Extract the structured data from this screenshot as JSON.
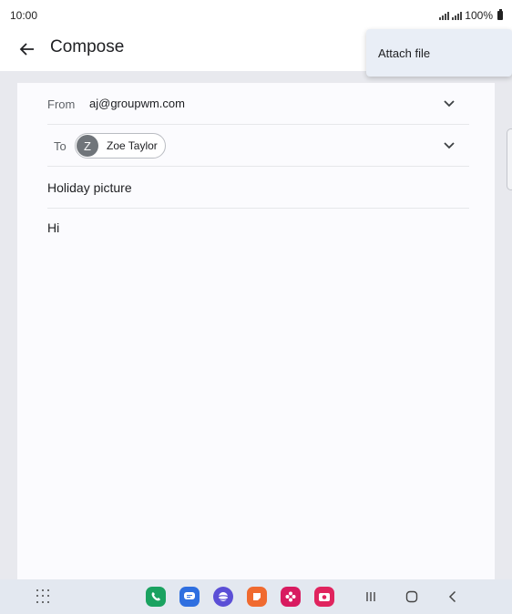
{
  "status_bar": {
    "time": "10:00",
    "battery": "100%",
    "icons": [
      "signal-icon",
      "signal-icon",
      "battery-icon"
    ]
  },
  "app_bar": {
    "title": "Compose",
    "back_icon": "arrow-back-icon"
  },
  "menu": {
    "items": [
      {
        "label": "Attach file"
      }
    ]
  },
  "compose": {
    "from": {
      "label": "From",
      "value": "aj@groupwm.com"
    },
    "to": {
      "label": "To",
      "recipient": {
        "initial": "Z",
        "name": "Zoe Taylor"
      }
    },
    "subject": "Holiday picture",
    "body": "Hi"
  },
  "nav_bar": {
    "dock_apps": [
      {
        "name": "phone-app-icon",
        "color": "#1aa260"
      },
      {
        "name": "messages-app-icon",
        "color": "#2f6fe0"
      },
      {
        "name": "internet-app-icon",
        "color": "#5b4fd6"
      },
      {
        "name": "notes-app-icon",
        "color": "#f06a2f"
      },
      {
        "name": "gallery-app-icon",
        "color": "#d81b60"
      },
      {
        "name": "camera-app-icon",
        "color": "#e0245e"
      }
    ],
    "buttons": [
      "recent-apps-icon",
      "home-icon",
      "back-nav-icon"
    ]
  }
}
